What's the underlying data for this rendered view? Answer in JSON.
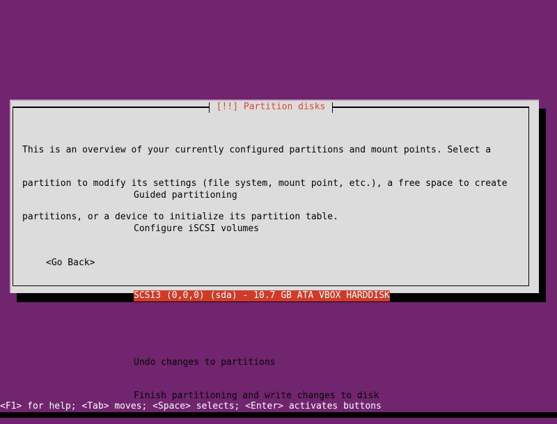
{
  "screen": {
    "background_color": "#72256f",
    "shadow_color": "#000000"
  },
  "dialog": {
    "title": "[!!] Partition disks",
    "title_color": "#d44c2b",
    "background_color": "#dcdcdc",
    "border_color": "#000000",
    "body_lines": [
      "This is an overview of your currently configured partitions and mount points. Select a",
      "partition to modify its settings (file system, mount point, etc.), a free space to create",
      "partitions, or a device to initialize its partition table."
    ],
    "menu": {
      "items": [
        {
          "label": "Guided partitioning",
          "selected": false
        },
        {
          "label": "Configure iSCSI volumes",
          "selected": false
        },
        {
          "label": "SCSI3 (0,0,0) (sda) - 10.7 GB ATA VBOX HARDDISK",
          "selected": true
        },
        {
          "label": "Undo changes to partitions",
          "selected": false
        },
        {
          "label": "Finish partitioning and write changes to disk",
          "selected": false
        }
      ],
      "selection_background": "#d03a28",
      "selection_foreground": "#ffffff"
    },
    "buttons": {
      "go_back": "<Go Back>"
    }
  },
  "status_bar": {
    "text": "<F1> for help; <Tab> moves; <Space> selects; <Enter> activates buttons",
    "foreground": "#ffffff"
  }
}
